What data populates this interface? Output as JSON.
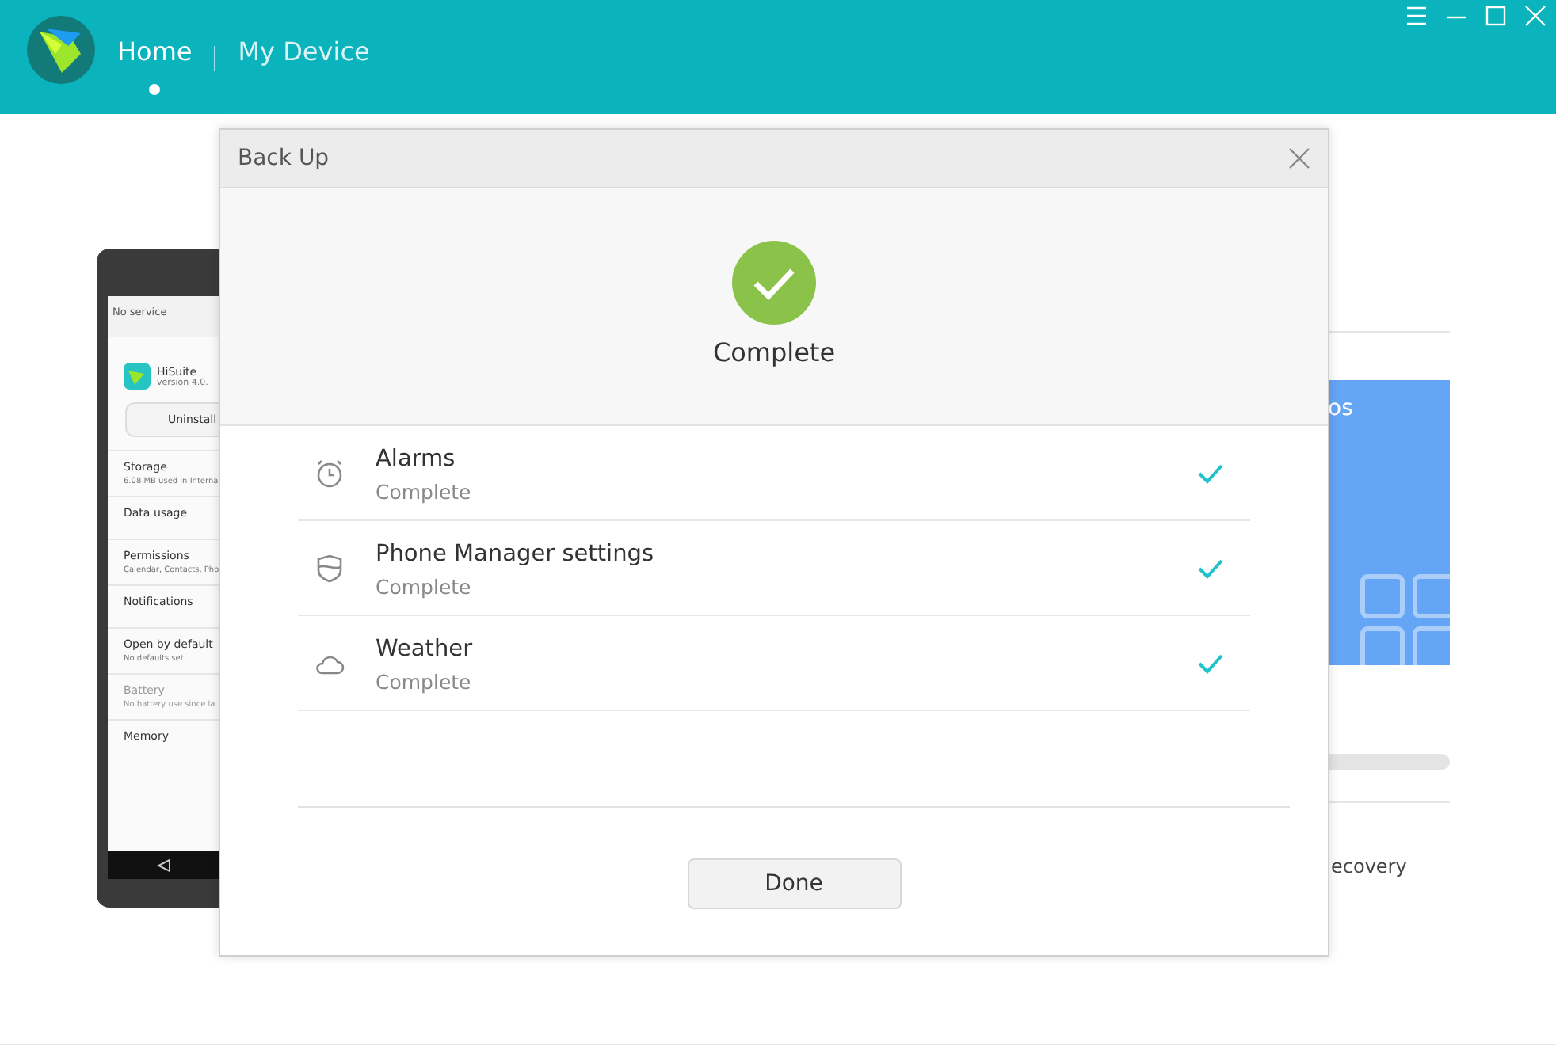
{
  "tabs": [
    {
      "label": "Home",
      "selected": true
    },
    {
      "label": "My Device",
      "selected": false
    }
  ],
  "phone": {
    "status": "No service",
    "app_name": "HiSuite",
    "app_version": "version 4.0.",
    "uninstall": "Uninstall",
    "settings": [
      {
        "title": "Storage",
        "detail": "6.08 MB used in Interna",
        "disabled": false
      },
      {
        "title": "Data usage",
        "disabled": false
      },
      {
        "title": "Permissions",
        "detail": "Calendar, Contacts, Pho",
        "disabled": false
      },
      {
        "title": "Notifications",
        "disabled": false
      },
      {
        "title": "Open by default",
        "detail": "No defaults set",
        "disabled": false
      },
      {
        "title": "Battery",
        "detail": "No battery use since la",
        "disabled": true
      },
      {
        "title": "Memory",
        "disabled": false
      }
    ]
  },
  "side_panel": {
    "card_title": "os",
    "recovery": "ecovery"
  },
  "dialog": {
    "title": "Back Up",
    "status": "Complete",
    "items": [
      {
        "kind": "alarm",
        "title": "Alarms",
        "status": "Complete",
        "done": true
      },
      {
        "kind": "shield",
        "title": "Phone Manager settings",
        "status": "Complete",
        "done": true
      },
      {
        "kind": "cloud",
        "title": "Weather",
        "status": "Complete",
        "done": true
      }
    ],
    "button": "Done"
  }
}
